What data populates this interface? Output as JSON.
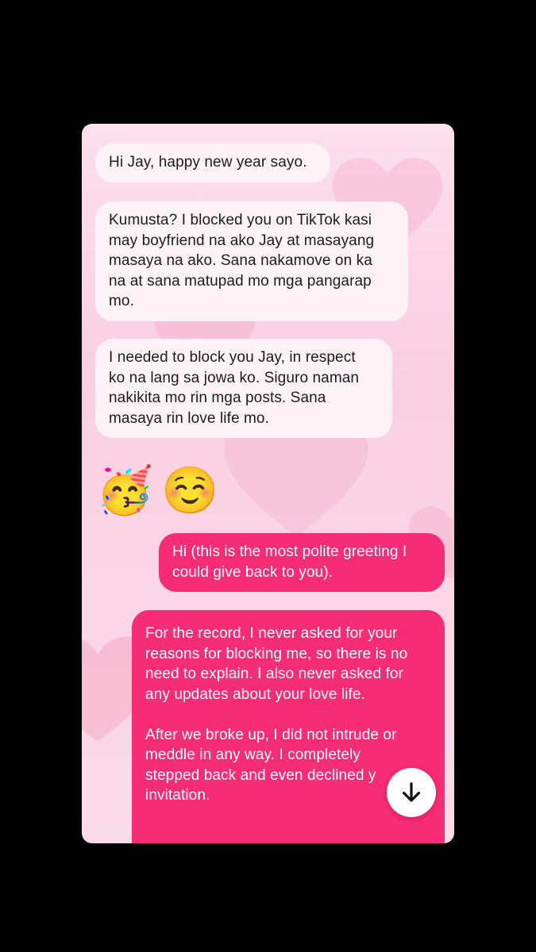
{
  "chat": {
    "messages": [
      {
        "direction": "incoming",
        "text": "Hi Jay, happy new year sayo."
      },
      {
        "direction": "incoming",
        "text": "Kumusta? I blocked you on TikTok kasi\nmay boyfriend na ako Jay at masayang\nmasaya na ako. Sana nakamove on ka\nna at sana matupad mo mga pangarap\nmo."
      },
      {
        "direction": "incoming",
        "text": "I needed to block you Jay, in respect\nko na lang sa jowa ko. Siguro naman\nnakikita mo rin mga posts. Sana\nmasaya rin love life mo."
      },
      {
        "direction": "outgoing",
        "text": "Hi (this is the most polite greeting I\ncould give back to you)."
      },
      {
        "direction": "outgoing",
        "text": "For the record, I never asked for your\nreasons for blocking me, so there is no\nneed to explain. I also never asked for\nany updates about your love life.\n\nAfter we broke up, I did not intrude or\nmeddle in any way. I completely\nstepped back and even declined y\ninvitation."
      }
    ],
    "emojis": [
      "🥳",
      "☺️"
    ]
  },
  "icons": {
    "scroll_down": "arrow-down-icon",
    "background": "heart-icon"
  },
  "colors": {
    "page_background": "#000000",
    "chat_background": "#f9cfe0",
    "incoming_bubble": "#fdf3f6",
    "outgoing_bubble": "#f62c75",
    "incoming_text": "#1c1c1e",
    "outgoing_text": "#ffffff"
  }
}
